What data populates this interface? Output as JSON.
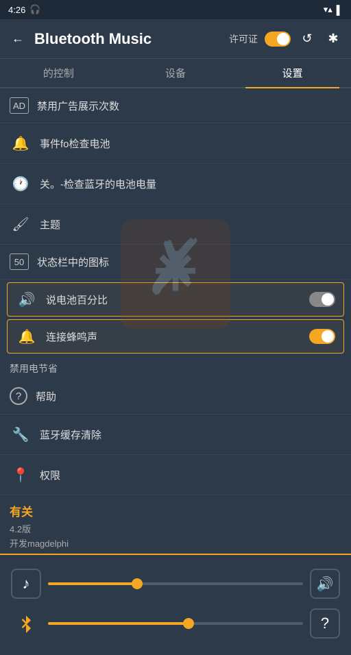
{
  "statusBar": {
    "time": "4:26",
    "headphoneIcon": "🎧",
    "wifiIcon": "▲",
    "batteryIcon": "🔋"
  },
  "header": {
    "backLabel": "←",
    "title": "Bluetooth Music",
    "permissionLabel": "许可证",
    "refreshIcon": "↺",
    "bluetoothIcon": "✱"
  },
  "tabs": [
    {
      "id": "control",
      "label": "的控制",
      "active": false
    },
    {
      "id": "device",
      "label": "设备",
      "active": false
    },
    {
      "id": "settings",
      "label": "设置",
      "active": true
    }
  ],
  "settingsItems": [
    {
      "id": "disable-ads",
      "iconUnicode": "AD",
      "label": "禁用广告展示次数"
    },
    {
      "id": "battery-check",
      "iconUnicode": "🔔",
      "label": "事件fo检查电池"
    },
    {
      "id": "bt-battery",
      "iconUnicode": "🕐",
      "label": "关。-检查蓝牙的电池电量"
    },
    {
      "id": "theme",
      "iconUnicode": "🖌",
      "label": "主题"
    },
    {
      "id": "statusbar-icon",
      "iconUnicode": "50",
      "label": "状态栏中的图标"
    }
  ],
  "toggleItems": [
    {
      "id": "battery-percent",
      "label": "说电池百分比",
      "state": "off"
    },
    {
      "id": "connect-beep",
      "label": "连接蜂鸣声",
      "state": "on"
    }
  ],
  "sectionLabel": "禁用电节省",
  "extraItems": [
    {
      "id": "help",
      "iconUnicode": "?",
      "label": "帮助"
    },
    {
      "id": "bt-cache",
      "iconUnicode": "🔧",
      "label": "蓝牙缓存清除"
    },
    {
      "id": "permissions",
      "iconUnicode": "📍",
      "label": "权限"
    }
  ],
  "about": {
    "title": "有关",
    "version": "4.2版",
    "developer": "开发magdelphi"
  },
  "player": {
    "musicSliderPercent": 35,
    "volumeSliderPercent": 55
  }
}
